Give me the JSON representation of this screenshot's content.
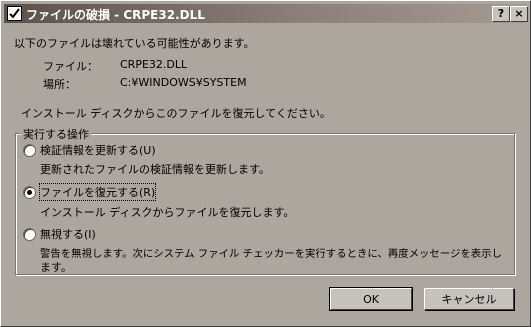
{
  "window": {
    "title": "ファイルの破損 -  CRPE32.DLL",
    "help_label": "?",
    "close_label": "×"
  },
  "message": "以下のファイルは壊れている可能性があります。",
  "file_info": {
    "file_label": "ファイル：",
    "file_value": "CRPE32.DLL",
    "location_label": "場所：",
    "location_value": "C:¥WINDOWS¥SYSTEM"
  },
  "instruction": "インストール ディスクからこのファイルを復元してください。",
  "actions": {
    "group_label": "実行する操作",
    "options": [
      {
        "label": "検証情報を更新する(U)",
        "description": "更新されたファイルの検証情報を更新します。",
        "checked": false
      },
      {
        "label": "ファイルを復元する(R)",
        "description": "インストール ディスクからファイルを復元します。",
        "checked": true
      },
      {
        "label": "無視する(I)",
        "description_line1": "警告を無視します。次にシステム ファイル チェッカーを実行するときに、再度メッセージを表示し",
        "description_line2": "ます。",
        "checked": false
      }
    ]
  },
  "buttons": {
    "ok_label": "OK",
    "cancel_label": "キャンセル"
  },
  "colors": {
    "titlebar_start": "#5b504a",
    "dialog_bg": "#ada69f"
  }
}
